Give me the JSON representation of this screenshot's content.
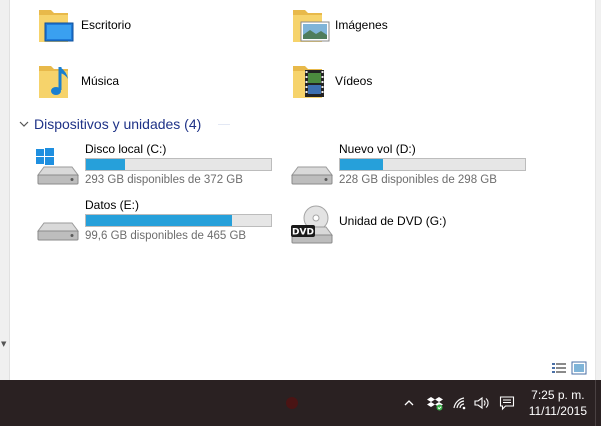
{
  "folders": [
    {
      "label": "Escritorio",
      "icon": "desktop-folder-icon"
    },
    {
      "label": "Imágenes",
      "icon": "pictures-folder-icon"
    },
    {
      "label": "Música",
      "icon": "music-folder-icon"
    },
    {
      "label": "Vídeos",
      "icon": "videos-folder-icon"
    }
  ],
  "devices_group": {
    "title": "Dispositivos y unidades (4)"
  },
  "drives": [
    {
      "name": "Disco local (C:)",
      "free_text": "293 GB disponibles de 372 GB",
      "used_fraction": 0.21,
      "icon": "windows-drive-icon"
    },
    {
      "name": "Nuevo vol (D:)",
      "free_text": "228 GB disponibles de 298 GB",
      "used_fraction": 0.23,
      "icon": "hard-drive-icon"
    },
    {
      "name": "Datos (E:)",
      "free_text": "99,6 GB disponibles de 465 GB",
      "used_fraction": 0.79,
      "icon": "hard-drive-icon"
    },
    {
      "name": "Unidad de DVD (G:)",
      "icon": "dvd-drive-icon",
      "badge": "DVD"
    }
  ],
  "taskbar": {
    "time": "7:25 p. m.",
    "date": "11/11/2015",
    "tray_icons": [
      "chevron-up-icon",
      "dropbox-icon",
      "wifi-icon",
      "volume-icon",
      "action-center-icon"
    ]
  },
  "colors": {
    "accent_fill": "#26a0da",
    "group_title": "#1e3287",
    "taskbar_bg": "#2a2122"
  }
}
